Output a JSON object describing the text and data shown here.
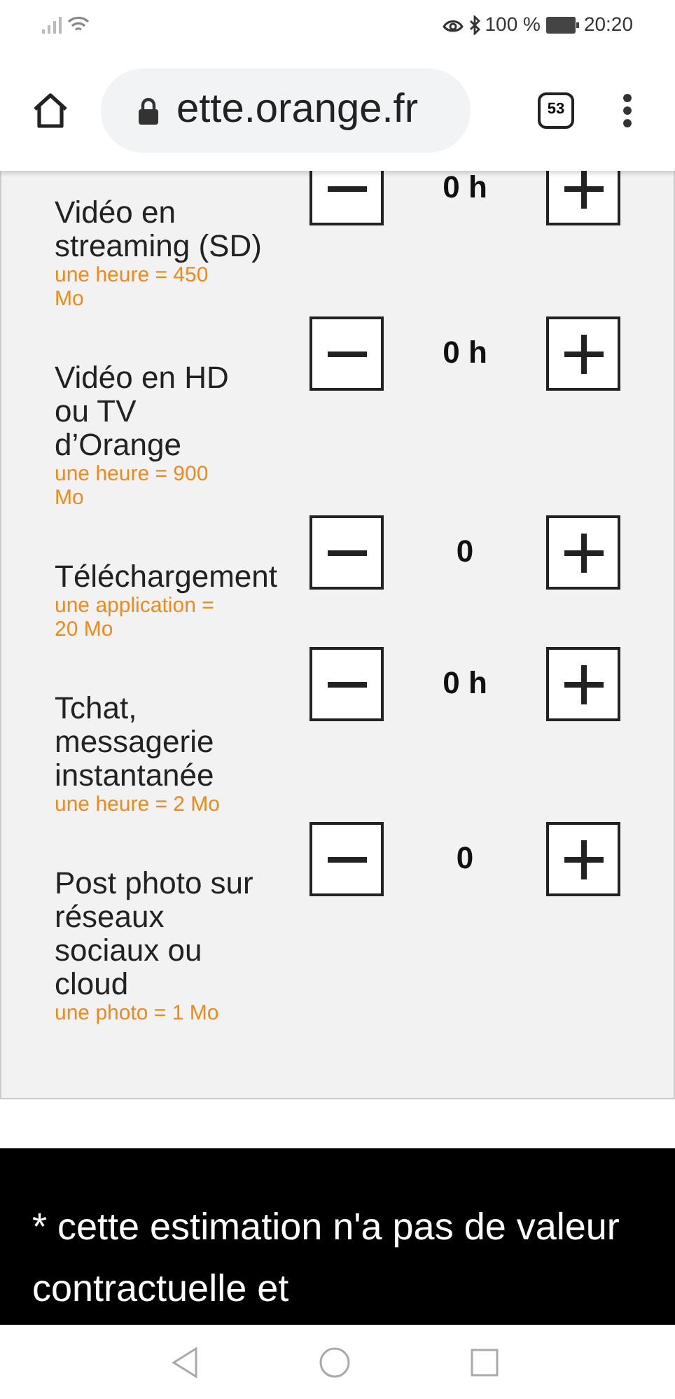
{
  "status_bar": {
    "battery": "100 %",
    "time": "20:20"
  },
  "toolbar": {
    "url": "ette.orange.fr",
    "tab_count": "53"
  },
  "items": [
    {
      "label": "Vidéo en streaming (SD)",
      "hint": "une heure = 450 Mo",
      "value": "0 h"
    },
    {
      "label": "Vidéo en HD ou TV d’Orange",
      "hint": "une heure = 900 Mo",
      "value": "0 h"
    },
    {
      "label": "Téléchargement",
      "hint": "une application = 20 Mo",
      "value": "0"
    },
    {
      "label": "Tchat, messagerie instantanée",
      "hint": "une heure = 2 Mo",
      "value": "0 h"
    },
    {
      "label": "Post photo sur réseaux sociaux ou cloud",
      "hint": "une photo = 1 Mo",
      "value": "0"
    }
  ],
  "footer": {
    "text": "* cette estimation n'a pas de valeur contractuelle et"
  }
}
